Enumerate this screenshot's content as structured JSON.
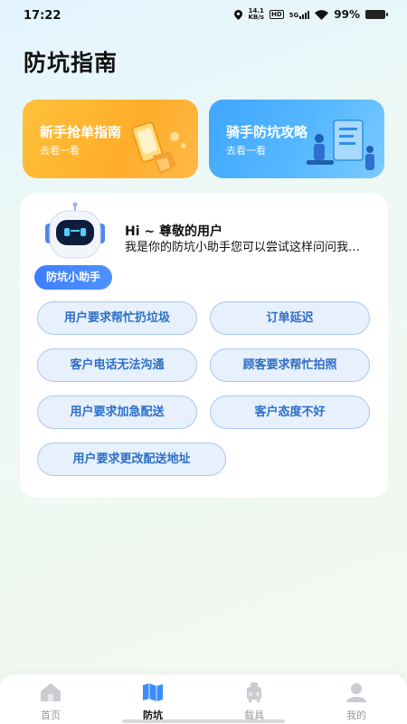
{
  "status_bar": {
    "time": "17:22",
    "net_speed_value": "14.1",
    "net_speed_unit": "KB/s",
    "hd": "HD",
    "network": "5G",
    "battery": "99%"
  },
  "page": {
    "title": "防坑指南"
  },
  "guide_cards": [
    {
      "title": "新手抢单指南",
      "subtitle": "去看一看",
      "color": "#ffb42e"
    },
    {
      "title": "骑手防坑攻略",
      "subtitle": "去看一看",
      "color": "#4aaeff"
    }
  ],
  "assistant": {
    "tag": "防坑小助手",
    "greeting_title": "Hi ~ 尊敬的用户",
    "greeting_body": "我是你的防坑小助手您可以尝试这样问问我…"
  },
  "questions": [
    "用户要求帮忙扔垃圾",
    "订单延迟",
    "客户电话无法沟通",
    "顾客要求帮忙拍照",
    "用户要求加急配送",
    "客户态度不好",
    "用户要求更改配送地址"
  ],
  "bottom_nav": {
    "items": [
      "首页",
      "防坑",
      "载具",
      "我的"
    ],
    "active": "防坑"
  },
  "colors": {
    "accent": "#3d7dff",
    "chip_text": "#2c6fc6"
  }
}
